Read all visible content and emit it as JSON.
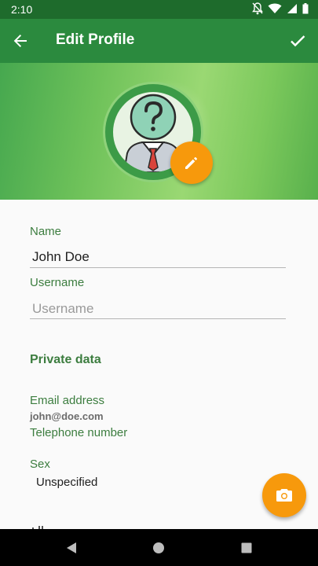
{
  "status_bar": {
    "time": "2:10"
  },
  "app_bar": {
    "title": "Edit Profile"
  },
  "form": {
    "name": {
      "label": "Name",
      "value": "John Doe"
    },
    "username": {
      "label": "Username",
      "placeholder": "Username"
    },
    "private_section": "Private data",
    "email": {
      "label": "Email address",
      "value": "john@doe.com"
    },
    "telephone": {
      "label": "Telephone number"
    },
    "sex": {
      "label": "Sex",
      "value": "Unspecified"
    }
  },
  "colors": {
    "app_bar": "#2b8a3e",
    "status_bar": "#1e6b2c",
    "accent": "#f7990c",
    "label": "#3c7d3f"
  },
  "icons": {
    "back": "arrow-back-icon",
    "done": "check-icon",
    "edit": "pencil-icon",
    "camera": "camera-icon",
    "avatar": "unknown-person-avatar"
  }
}
